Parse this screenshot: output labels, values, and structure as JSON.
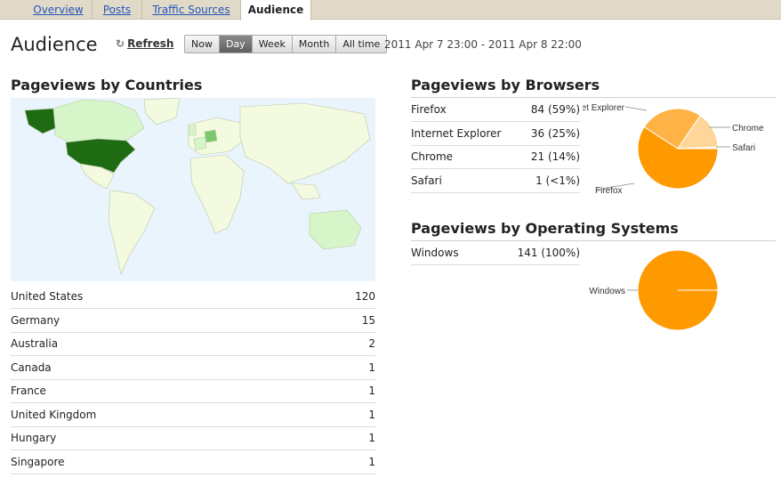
{
  "tabs": [
    {
      "label": "Overview"
    },
    {
      "label": "Posts"
    },
    {
      "label": "Traffic Sources"
    },
    {
      "label": "Audience"
    }
  ],
  "header": {
    "title": "Audience",
    "refresh_label": "Refresh",
    "refresh_icon": "refresh-icon",
    "ranges": [
      "Now",
      "Day",
      "Week",
      "Month",
      "All time"
    ],
    "active_range": "Day",
    "date_range": "2011 Apr 7 23:00 - 2011 Apr 8 22:00"
  },
  "countries": {
    "title": "Pageviews by Countries",
    "rows": [
      {
        "name": "United States",
        "value": "120"
      },
      {
        "name": "Germany",
        "value": "15"
      },
      {
        "name": "Australia",
        "value": "2"
      },
      {
        "name": "Canada",
        "value": "1"
      },
      {
        "name": "France",
        "value": "1"
      },
      {
        "name": "United Kingdom",
        "value": "1"
      },
      {
        "name": "Hungary",
        "value": "1"
      },
      {
        "name": "Singapore",
        "value": "1"
      }
    ]
  },
  "browsers": {
    "title": "Pageviews by Browsers",
    "rows": [
      {
        "name": "Firefox",
        "value": "84 (59%)"
      },
      {
        "name": "Internet Explorer",
        "value": "36 (25%)"
      },
      {
        "name": "Chrome",
        "value": "21 (14%)"
      },
      {
        "name": "Safari",
        "value": "1 (<1%)"
      }
    ]
  },
  "os": {
    "title": "Pageviews by Operating Systems",
    "rows": [
      {
        "name": "Windows",
        "value": "141 (100%)"
      }
    ]
  },
  "colors": {
    "accent": "#ff9900",
    "map_high": "#1f6b13",
    "map_low": "#d6f5c8",
    "map_land": "#f4fadf",
    "map_water": "#eaf4fc"
  },
  "chart_data": [
    {
      "type": "pie",
      "categories": [
        "Firefox",
        "Internet Explorer",
        "Chrome",
        "Safari"
      ],
      "values": [
        84,
        36,
        21,
        1
      ],
      "colors": [
        "#ff9900",
        "#ffb347",
        "#ffd699",
        "#fff0d6"
      ],
      "labels": [
        "Firefox",
        "et Explorer",
        "Chrome",
        "Safari"
      ]
    },
    {
      "type": "pie",
      "categories": [
        "Windows"
      ],
      "values": [
        141
      ],
      "colors": [
        "#ff9900"
      ],
      "labels": [
        "Windows"
      ]
    }
  ]
}
